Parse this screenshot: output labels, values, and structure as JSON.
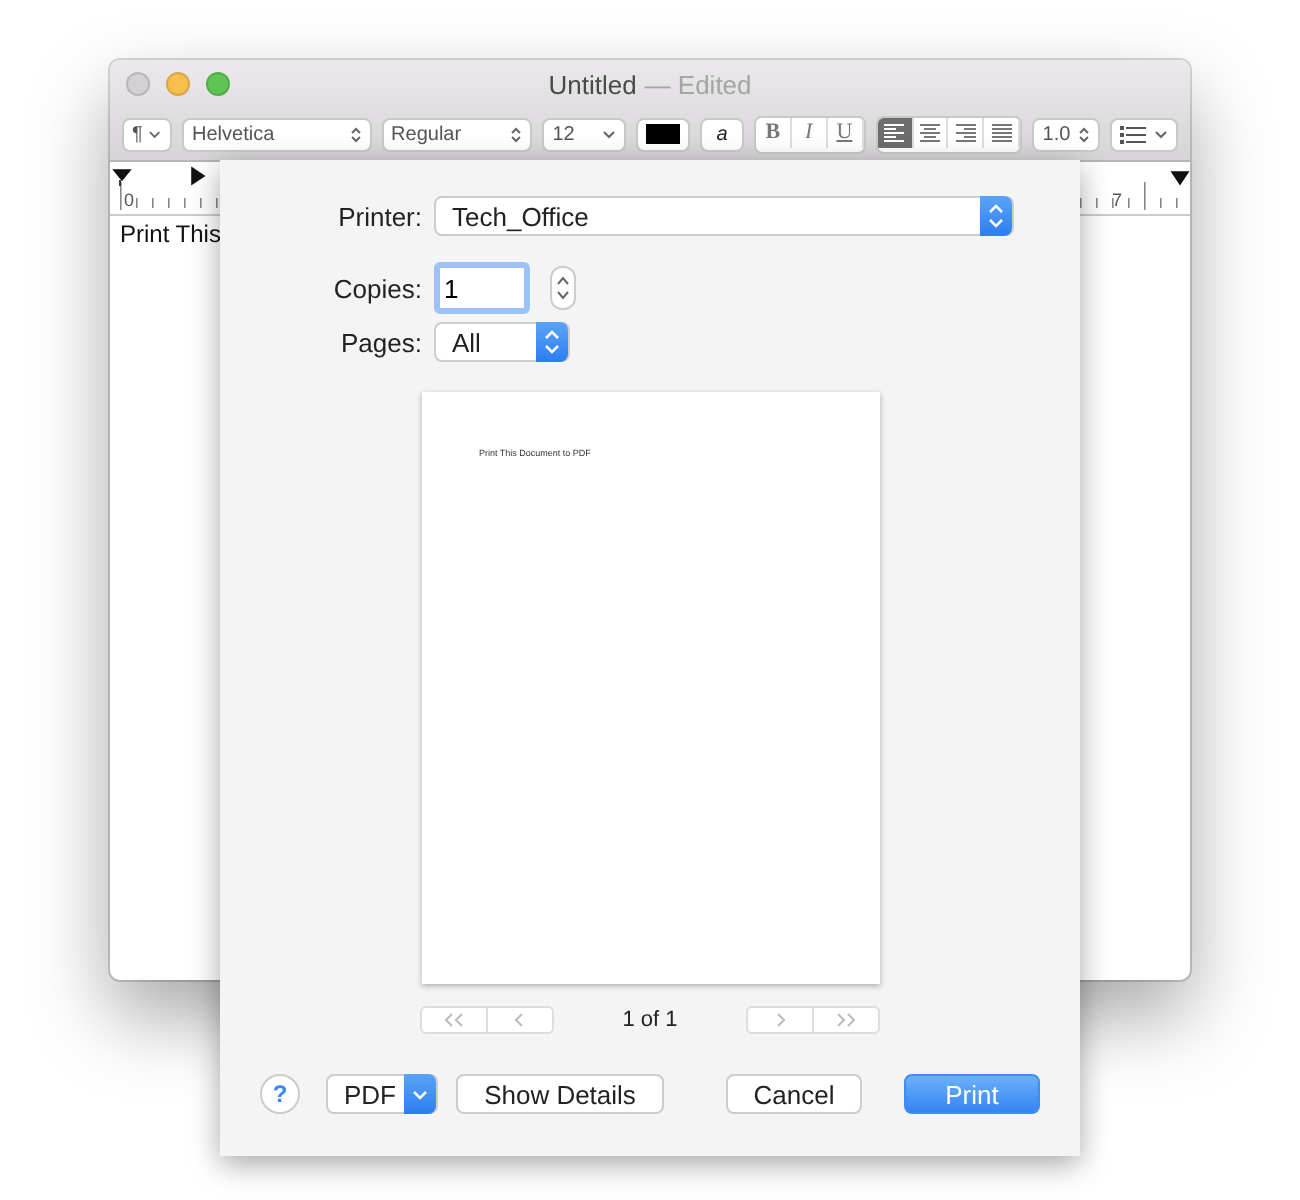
{
  "window": {
    "title": "Untitled",
    "status": "— Edited"
  },
  "toolbar": {
    "paragraph": "¶",
    "font": "Helvetica",
    "typeface": "Regular",
    "size": "12",
    "highlight": "a",
    "styles": [
      "B",
      "I",
      "U"
    ],
    "alignment": [
      {
        "kind": "left",
        "selected": true
      },
      {
        "kind": "center",
        "selected": false
      },
      {
        "kind": "right",
        "selected": false
      },
      {
        "kind": "justify",
        "selected": false
      }
    ],
    "spacing": "1.0"
  },
  "ruler": {
    "labels": [
      "0",
      "7"
    ]
  },
  "document": {
    "text": "Print This"
  },
  "print_dialog": {
    "printer": {
      "label": "Printer:",
      "value": "Tech_Office"
    },
    "copies": {
      "label": "Copies:",
      "value": "1"
    },
    "pages": {
      "label": "Pages:",
      "value": "All"
    },
    "preview": {
      "text": "Print This Document to PDF"
    },
    "page_indicator": "1 of 1",
    "help": "?",
    "pdf": "PDF",
    "show_details": "Show Details",
    "cancel": "Cancel",
    "print": "Print"
  }
}
